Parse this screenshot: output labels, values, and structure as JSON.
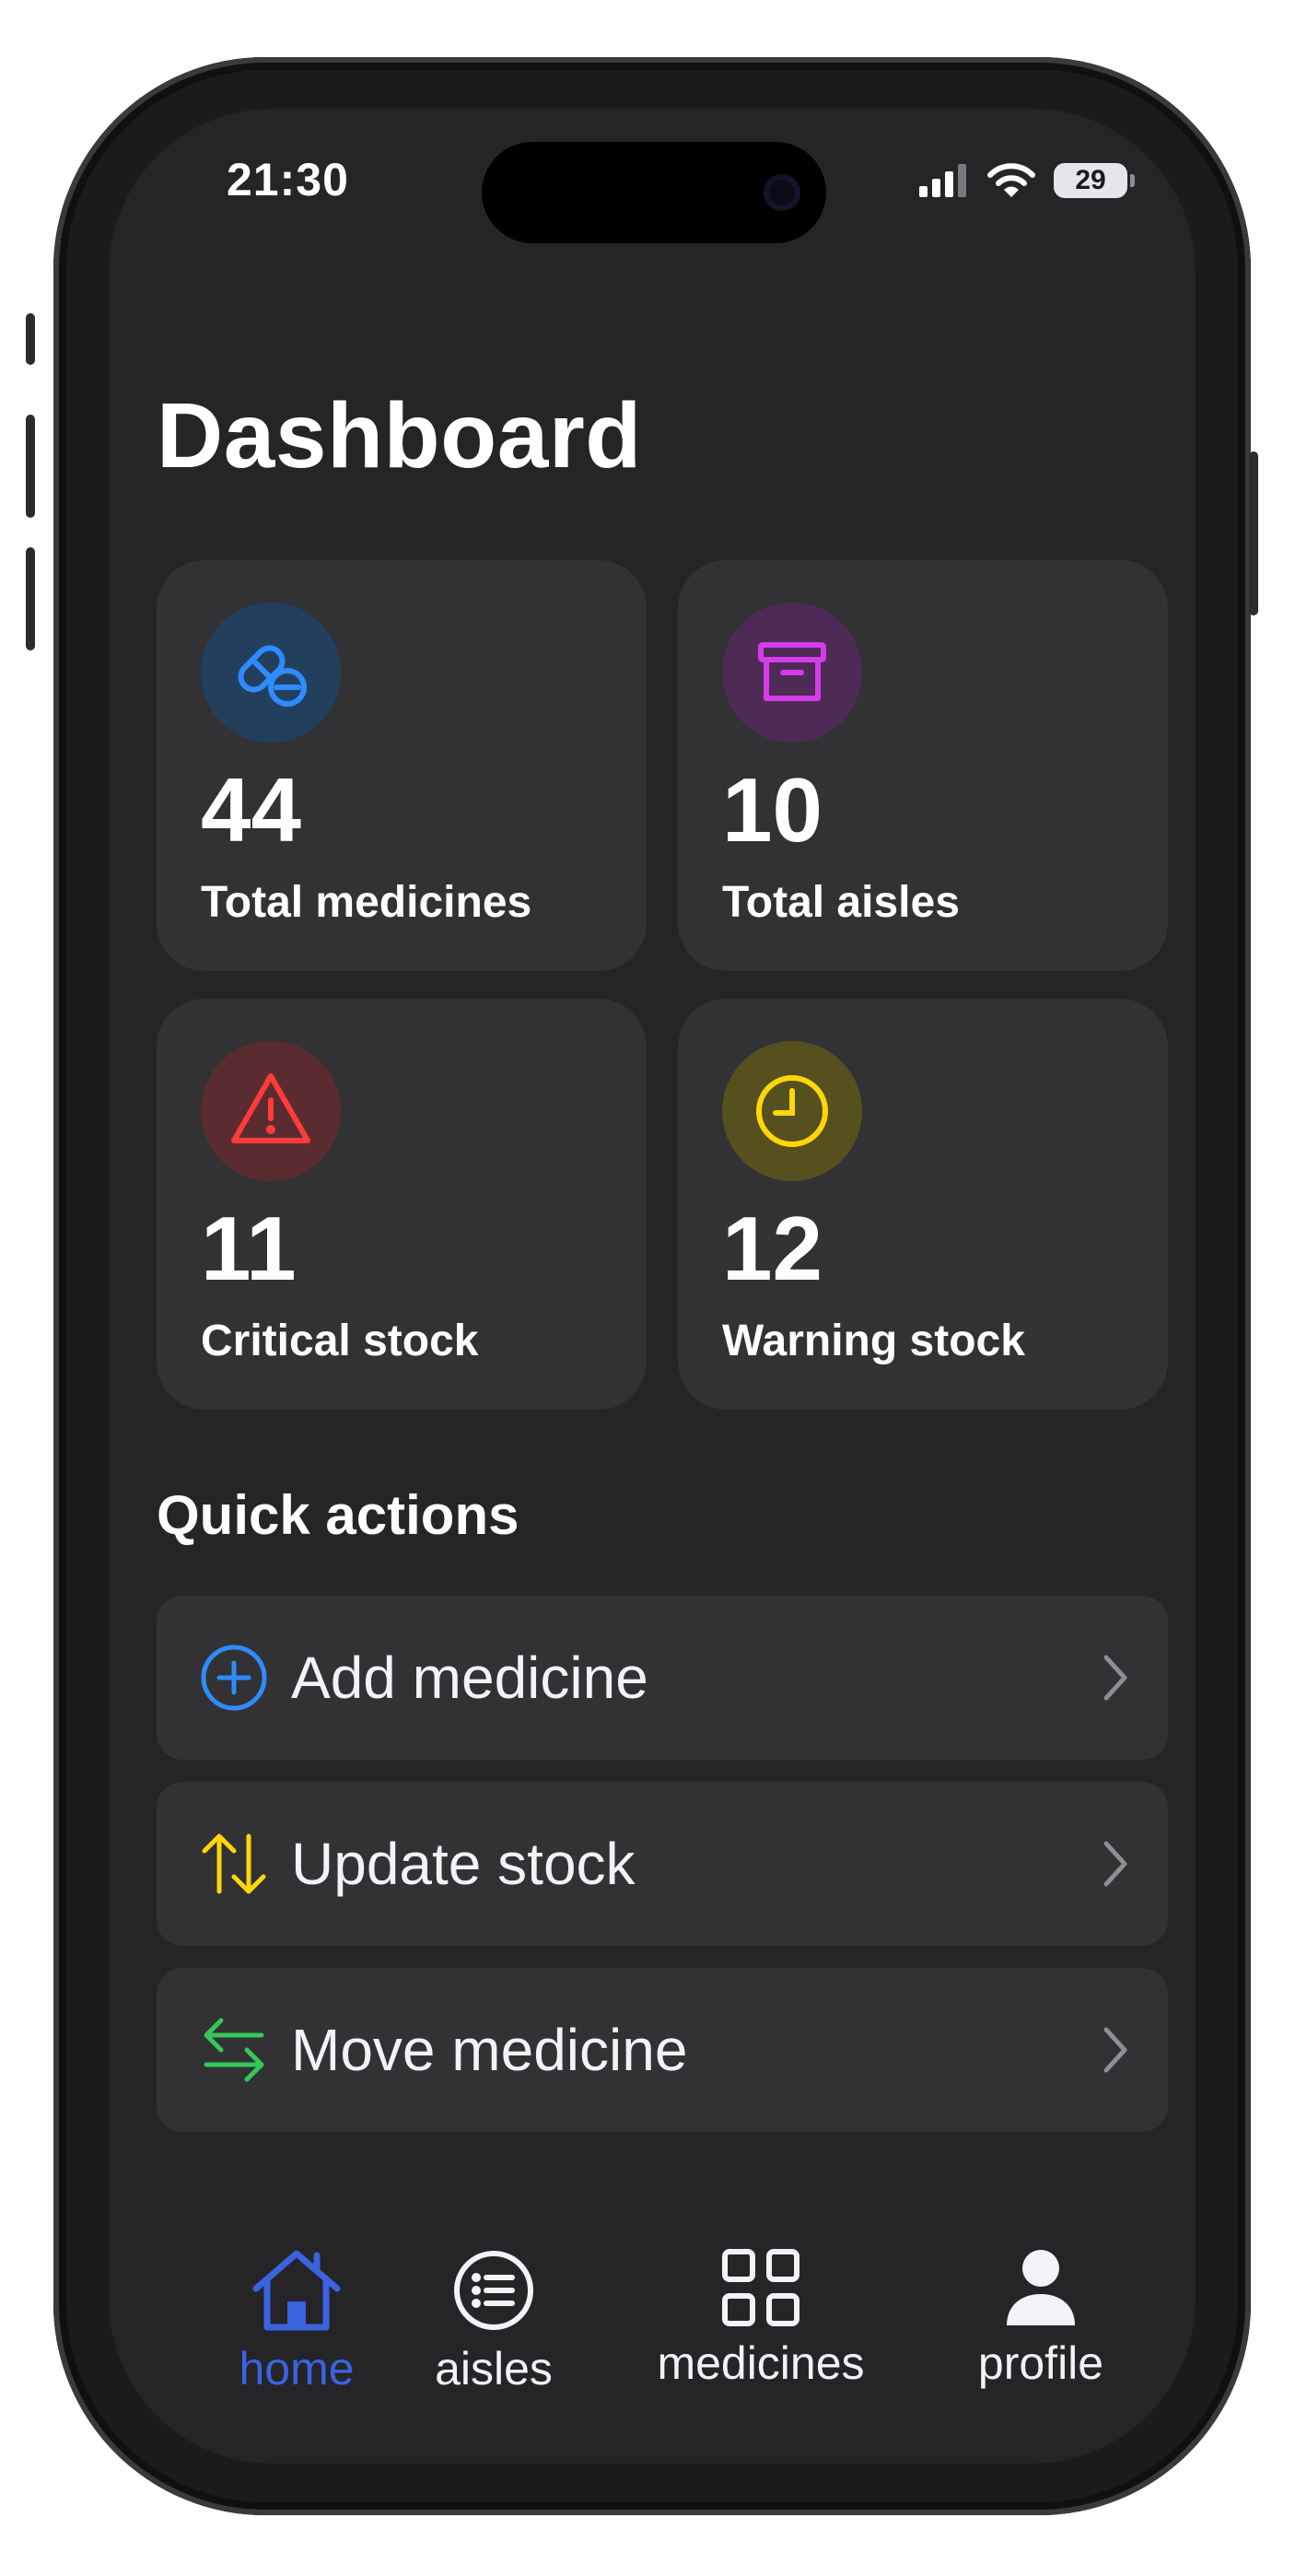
{
  "status_bar": {
    "time": "21:30",
    "battery": "29"
  },
  "page": {
    "title": "Dashboard"
  },
  "stats": [
    {
      "value": "44",
      "label": "Total medicines",
      "icon": "pills-icon",
      "color": "#2f8cff",
      "bg": "#22405e"
    },
    {
      "value": "10",
      "label": "Total aisles",
      "icon": "archive-box-icon",
      "color": "#d63ce8",
      "bg": "#4d2b56"
    },
    {
      "value": "11",
      "label": "Critical stock",
      "icon": "warning-triangle-icon",
      "color": "#ff3b3b",
      "bg": "#5a2c2f"
    },
    {
      "value": "12",
      "label": "Warning stock",
      "icon": "clock-icon",
      "color": "#ffd60a",
      "bg": "#55501e"
    }
  ],
  "quick_actions": {
    "title": "Quick actions",
    "items": [
      {
        "label": "Add medicine",
        "icon": "plus-circle-icon",
        "color": "#2f8cff"
      },
      {
        "label": "Update stock",
        "icon": "arrows-up-down-icon",
        "color": "#ffd60a"
      },
      {
        "label": "Move medicine",
        "icon": "arrows-left-right-icon",
        "color": "#34c759"
      }
    ]
  },
  "tab_bar": {
    "active": "home",
    "accent": "#3a63e0",
    "items": [
      {
        "label": "home",
        "icon": "house-icon"
      },
      {
        "label": "aisles",
        "icon": "list-circle-icon"
      },
      {
        "label": "medicines",
        "icon": "grid-icon"
      },
      {
        "label": "profile",
        "icon": "person-icon"
      }
    ]
  }
}
